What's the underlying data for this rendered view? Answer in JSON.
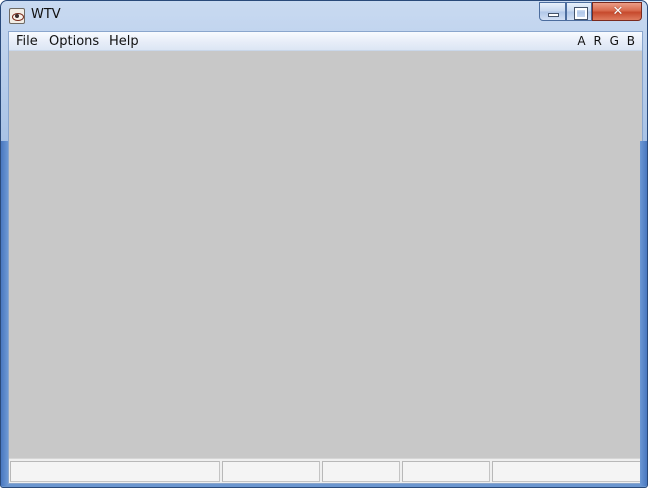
{
  "window": {
    "title": "WTV",
    "icons": {
      "app": "eye-icon",
      "minimize": "minimize-icon",
      "maximize": "maximize-icon",
      "close": "close-icon"
    }
  },
  "menubar": {
    "items": [
      {
        "label": "File"
      },
      {
        "label": "Options"
      },
      {
        "label": "Help"
      }
    ],
    "channels": [
      "A",
      "R",
      "G",
      "B"
    ]
  },
  "colors": {
    "viewport_background": "#c8c8c8",
    "title_text": "#101010",
    "close_button": "#d86a4d"
  },
  "statusbar": {
    "cells": [
      "",
      "",
      "",
      "",
      ""
    ]
  }
}
